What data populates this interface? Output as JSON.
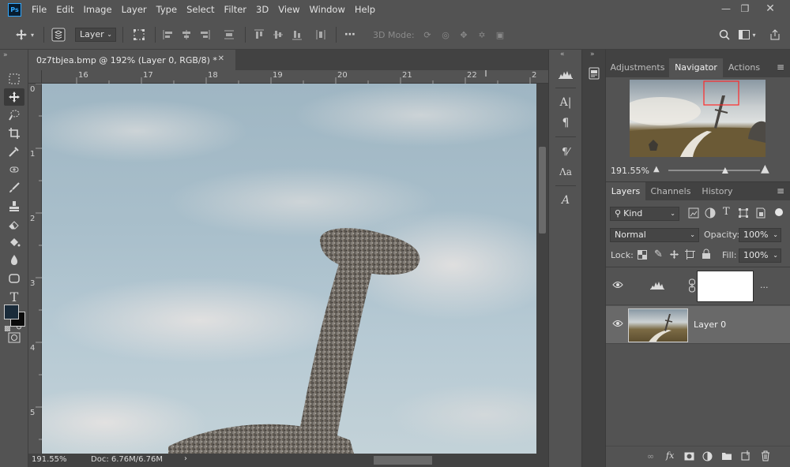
{
  "menu": [
    "File",
    "Edit",
    "Image",
    "Layer",
    "Type",
    "Select",
    "Filter",
    "3D",
    "View",
    "Window",
    "Help"
  ],
  "app_logo": "Ps",
  "options": {
    "layer_select": "Layer",
    "mode_3d": "3D Mode:"
  },
  "doc_tab": {
    "title": "0z7tbjea.bmp @ 192% (Layer 0, RGB/8) *"
  },
  "ruler_h": [
    "16",
    "17",
    "18",
    "19",
    "20",
    "21",
    "22",
    "2"
  ],
  "ruler_v": [
    "0",
    "1",
    "2",
    "3",
    "4",
    "5"
  ],
  "status": {
    "zoom": "191.55%",
    "doc": "Doc: 6.76M/6.76M"
  },
  "panel_top_tabs": [
    "Adjustments",
    "Navigator",
    "Actions"
  ],
  "navigator": {
    "zoom": "191.55%",
    "zoom_slider": 0.62
  },
  "layers_tabs": [
    "Layers",
    "Channels",
    "History"
  ],
  "layers": {
    "filter_kind": "Kind",
    "blend_mode": "Normal",
    "opacity_label": "Opacity:",
    "opacity": "100%",
    "lock_label": "Lock:",
    "fill_label": "Fill:",
    "fill": "100%",
    "items": [
      {
        "name": "..."
      },
      {
        "name": "Layer 0"
      }
    ]
  },
  "colors": {
    "panel": "#535353",
    "dark": "#424242",
    "accent": "#31a8ff",
    "selected_layer": "#696969"
  }
}
